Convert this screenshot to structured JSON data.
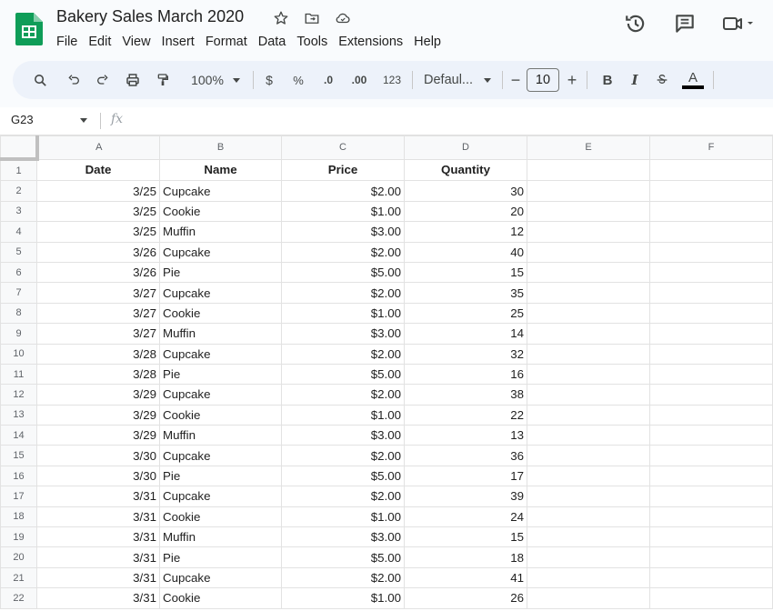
{
  "app": {
    "title": "Bakery Sales March 2020",
    "menu": [
      "File",
      "Edit",
      "View",
      "Insert",
      "Format",
      "Data",
      "Tools",
      "Extensions",
      "Help"
    ]
  },
  "toolbar": {
    "zoom": "100%",
    "currency": "$",
    "percent": "%",
    "decrease_decimal": ".0",
    "increase_decimal": ".00",
    "number_format": "123",
    "font": "Defaul...",
    "font_size": "10",
    "bold": "B",
    "italic": "I",
    "text_color_label": "A"
  },
  "formula_bar": {
    "name_box": "G23",
    "fx": "fx"
  },
  "columns": [
    "A",
    "B",
    "C",
    "D",
    "E",
    "F"
  ],
  "header_row": [
    "Date",
    "Name",
    "Price",
    "Quantity"
  ],
  "rows": [
    [
      "3/25",
      "Cupcake",
      "$2.00",
      "30"
    ],
    [
      "3/25",
      "Cookie",
      "$1.00",
      "20"
    ],
    [
      "3/25",
      "Muffin",
      "$3.00",
      "12"
    ],
    [
      "3/26",
      "Cupcake",
      "$2.00",
      "40"
    ],
    [
      "3/26",
      "Pie",
      "$5.00",
      "15"
    ],
    [
      "3/27",
      "Cupcake",
      "$2.00",
      "35"
    ],
    [
      "3/27",
      "Cookie",
      "$1.00",
      "25"
    ],
    [
      "3/27",
      "Muffin",
      "$3.00",
      "14"
    ],
    [
      "3/28",
      "Cupcake",
      "$2.00",
      "32"
    ],
    [
      "3/28",
      "Pie",
      "$5.00",
      "16"
    ],
    [
      "3/29",
      "Cupcake",
      "$2.00",
      "38"
    ],
    [
      "3/29",
      "Cookie",
      "$1.00",
      "22"
    ],
    [
      "3/29",
      "Muffin",
      "$3.00",
      "13"
    ],
    [
      "3/30",
      "Cupcake",
      "$2.00",
      "36"
    ],
    [
      "3/30",
      "Pie",
      "$5.00",
      "17"
    ],
    [
      "3/31",
      "Cupcake",
      "$2.00",
      "39"
    ],
    [
      "3/31",
      "Cookie",
      "$1.00",
      "24"
    ],
    [
      "3/31",
      "Muffin",
      "$3.00",
      "15"
    ],
    [
      "3/31",
      "Pie",
      "$5.00",
      "18"
    ],
    [
      "3/31",
      "Cupcake",
      "$2.00",
      "41"
    ],
    [
      "3/31",
      "Cookie",
      "$1.00",
      "26"
    ]
  ],
  "colors": {
    "sheets_green": "#0f9d58",
    "toolbar_bg": "#edf2fa",
    "header_bg": "#f8f9fa",
    "grid_line": "#e2e2e2"
  }
}
